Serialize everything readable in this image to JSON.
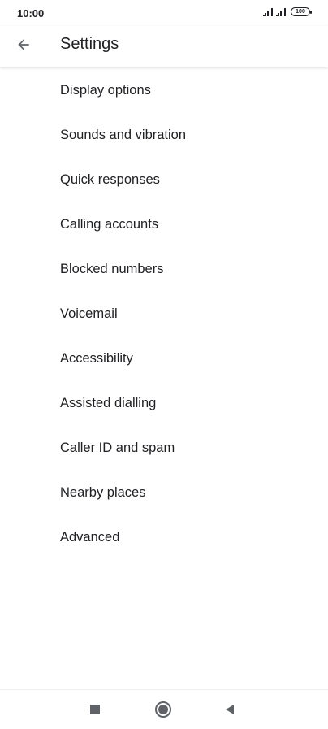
{
  "status_bar": {
    "time": "10:00",
    "battery": "100"
  },
  "header": {
    "title": "Settings",
    "back_icon": "arrow-back-icon"
  },
  "settings": {
    "items": [
      {
        "label": "Display options"
      },
      {
        "label": "Sounds and vibration"
      },
      {
        "label": "Quick responses"
      },
      {
        "label": "Calling accounts"
      },
      {
        "label": "Blocked numbers"
      },
      {
        "label": "Voicemail"
      },
      {
        "label": "Accessibility"
      },
      {
        "label": "Assisted dialling"
      },
      {
        "label": "Caller ID and spam"
      },
      {
        "label": "Nearby places"
      },
      {
        "label": "Advanced"
      }
    ]
  },
  "nav_bar": {
    "icons": [
      "square-recents-icon",
      "circle-home-icon",
      "triangle-back-icon"
    ]
  },
  "colors": {
    "text": "#202124",
    "icon": "#5f6368",
    "background": "#ffffff"
  }
}
